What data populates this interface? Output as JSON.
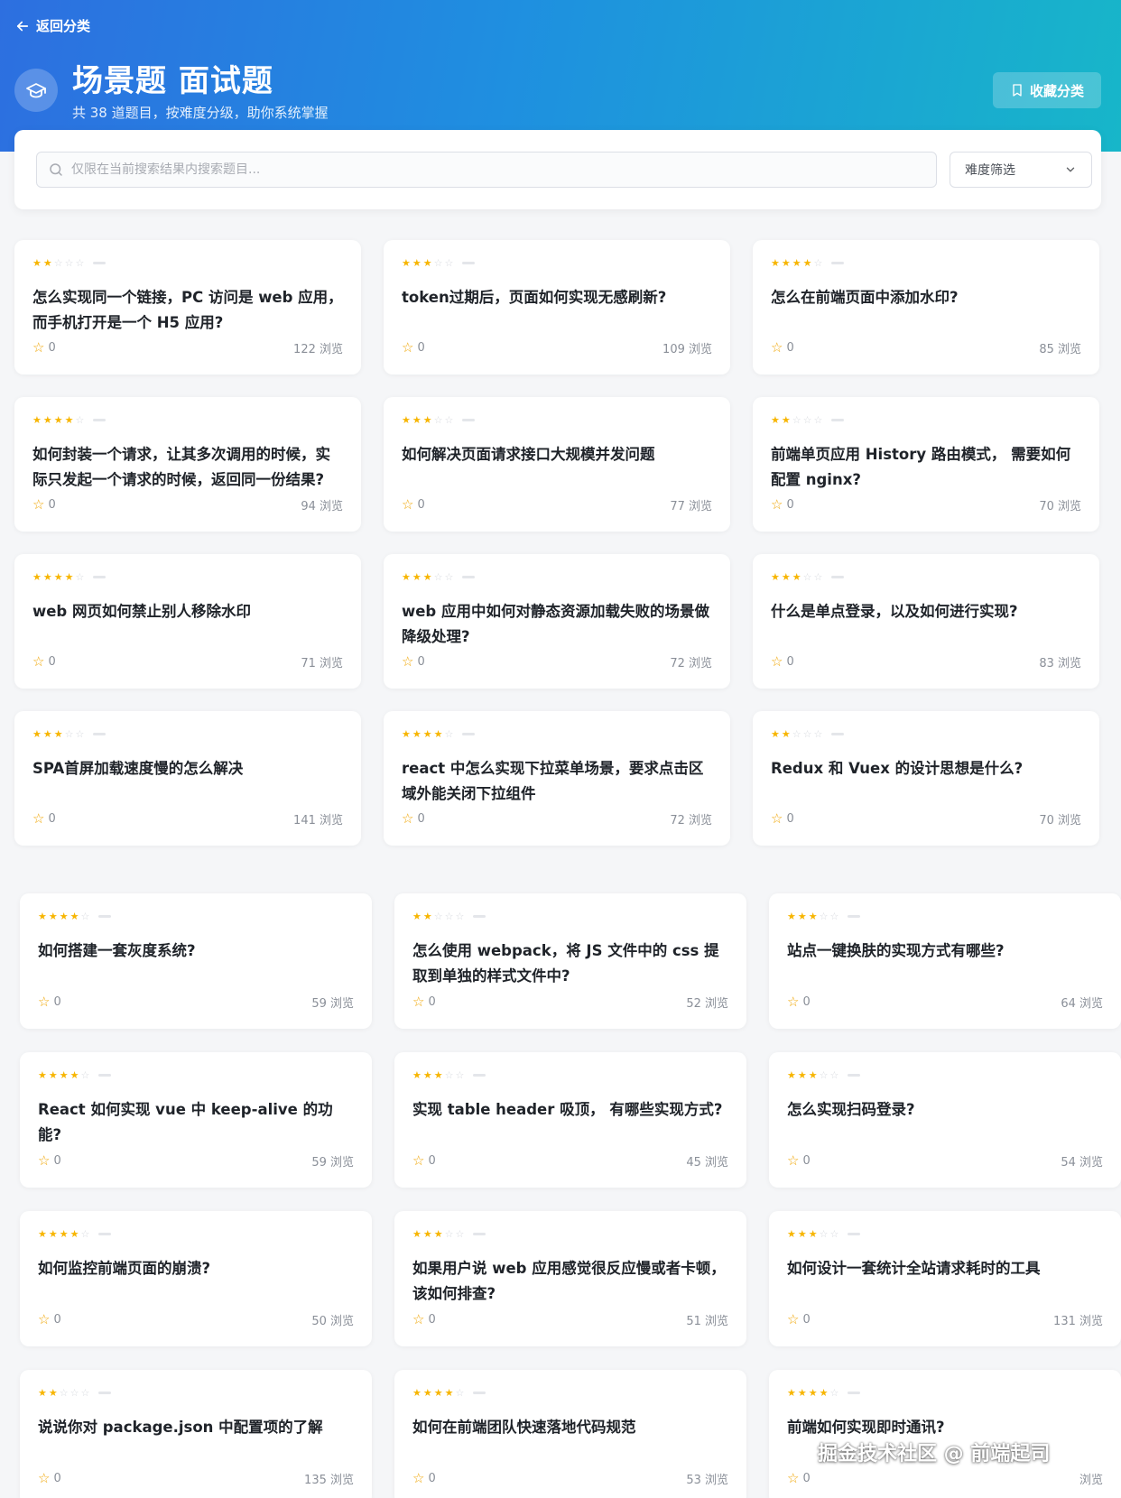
{
  "header": {
    "back_label": "返回分类",
    "title": "场景题 面试题",
    "subtitle": "共 38 道题目，按难度分级，助你系统掌握",
    "favorite_button": "收藏分类"
  },
  "search": {
    "placeholder": "仅限在当前搜索结果内搜索题目...",
    "value": ""
  },
  "filter": {
    "label": "难度筛选"
  },
  "icons": {
    "back": "arrow-left-icon",
    "category": "graduation-cap-icon",
    "favorite": "bookmark-icon",
    "search": "search-icon",
    "dropdown": "chevron-down-icon",
    "star": "star-icon"
  },
  "colors": {
    "accent_start": "#2d6fe0",
    "accent_end": "#17b6c9",
    "star": "#f7b500"
  },
  "cards_section1": [
    {
      "difficulty": 2,
      "title": "怎么实现同一个链接，PC 访问是 web 应用，而手机打开是一个 H5 应用?",
      "favorites": "0",
      "views": "122 浏览"
    },
    {
      "difficulty": 3,
      "title": "token过期后，页面如何实现无感刷新?",
      "favorites": "0",
      "views": "109 浏览"
    },
    {
      "difficulty": 4,
      "title": "怎么在前端页面中添加水印?",
      "favorites": "0",
      "views": "85 浏览"
    },
    {
      "difficulty": 4,
      "title": "如何封装一个请求，让其多次调用的时候，实际只发起一个请求的时候，返回同一份结果?",
      "favorites": "0",
      "views": "94 浏览"
    },
    {
      "difficulty": 3,
      "title": "如何解决页面请求接口大规模并发问题",
      "favorites": "0",
      "views": "77 浏览"
    },
    {
      "difficulty": 2,
      "title": "前端单页应用 History 路由模式， 需要如何配置 nginx?",
      "favorites": "0",
      "views": "70 浏览"
    },
    {
      "difficulty": 4,
      "title": "web 网页如何禁止别人移除水印",
      "favorites": "0",
      "views": "71 浏览"
    },
    {
      "difficulty": 3,
      "title": "web 应用中如何对静态资源加载失败的场景做降级处理?",
      "favorites": "0",
      "views": "72 浏览"
    },
    {
      "difficulty": 3,
      "title": "什么是单点登录，以及如何进行实现?",
      "favorites": "0",
      "views": "83 浏览"
    },
    {
      "difficulty": 3,
      "title": "SPA首屏加载速度慢的怎么解决",
      "favorites": "0",
      "views": "141 浏览"
    },
    {
      "difficulty": 4,
      "title": "react 中怎么实现下拉菜单场景，要求点击区域外能关闭下拉组件",
      "favorites": "0",
      "views": "72 浏览"
    },
    {
      "difficulty": 2,
      "title": "Redux 和 Vuex 的设计思想是什么?",
      "favorites": "0",
      "views": "70 浏览"
    }
  ],
  "cards_section2": [
    {
      "difficulty": 4,
      "title": "如何搭建一套灰度系统?",
      "favorites": "0",
      "views": "59 浏览"
    },
    {
      "difficulty": 2,
      "title": "怎么使用 webpack，将 JS 文件中的 css 提取到单独的样式文件中?",
      "favorites": "0",
      "views": "52 浏览"
    },
    {
      "difficulty": 3,
      "title": "站点一键换肤的实现方式有哪些?",
      "favorites": "0",
      "views": "64 浏览"
    },
    {
      "difficulty": 4,
      "title": "React 如何实现 vue 中 keep-alive 的功能?",
      "favorites": "0",
      "views": "59 浏览"
    },
    {
      "difficulty": 3,
      "title": "实现 table header 吸顶， 有哪些实现方式?",
      "favorites": "0",
      "views": "45 浏览"
    },
    {
      "difficulty": 3,
      "title": "怎么实现扫码登录?",
      "favorites": "0",
      "views": "54 浏览"
    },
    {
      "difficulty": 4,
      "title": "如何监控前端页面的崩溃?",
      "favorites": "0",
      "views": "50 浏览"
    },
    {
      "difficulty": 3,
      "title": "如果用户说 web 应用感觉很反应慢或者卡顿，该如何排查?",
      "favorites": "0",
      "views": "51 浏览"
    },
    {
      "difficulty": 3,
      "title": "如何设计一套统计全站请求耗时的工具",
      "favorites": "0",
      "views": "131 浏览"
    },
    {
      "difficulty": 2,
      "title": "说说你对 package.json 中配置项的了解",
      "favorites": "0",
      "views": "135 浏览"
    },
    {
      "difficulty": 4,
      "title": "如何在前端团队快速落地代码规范",
      "favorites": "0",
      "views": "53 浏览"
    },
    {
      "difficulty": 4,
      "title": "前端如何实现即时通讯?",
      "favorites": "0",
      "views": "浏览"
    }
  ],
  "watermark": "掘金技术社区 @ 前端起司"
}
